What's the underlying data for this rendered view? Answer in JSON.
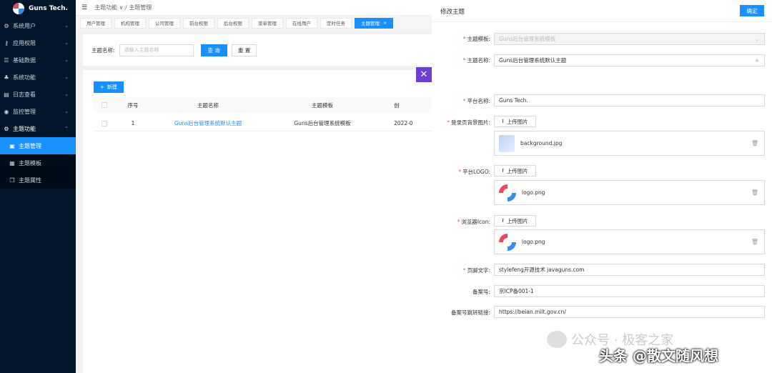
{
  "app": {
    "brand": "Guns Tech."
  },
  "sidebar": {
    "items": [
      {
        "label": "系统用户",
        "icon": "gear-icon"
      },
      {
        "label": "应用权限",
        "icon": "key-icon"
      },
      {
        "label": "基础数据",
        "icon": "list-icon"
      },
      {
        "label": "系统功能",
        "icon": "cluster-icon"
      },
      {
        "label": "日志查看",
        "icon": "file-icon"
      },
      {
        "label": "监控管理",
        "icon": "monitor-icon"
      },
      {
        "label": "主题功能",
        "icon": "gear-icon"
      }
    ],
    "subitems": [
      {
        "label": "主题管理"
      },
      {
        "label": "主题模板"
      },
      {
        "label": "主题属性"
      }
    ]
  },
  "header": {
    "breadcrumb": "主题功能 ∨ / 主题管理"
  },
  "tabs": [
    "用户管理",
    "机构管理",
    "公司管理",
    "前台权限",
    "后台权限",
    "菜单管理",
    "在线用户",
    "定时任务",
    "主题管理"
  ],
  "search": {
    "label": "主题名称:",
    "placeholder": "请输入主题名称",
    "query_label": "查 询",
    "reset_label": "重 置"
  },
  "table": {
    "new_label": "新建",
    "columns": [
      "序号",
      "主题名称",
      "主题模板",
      "创"
    ],
    "rows": [
      {
        "index": "1",
        "name": "Guns后台管理系统默认主题",
        "template": "Guns后台管理系统模板",
        "date": "2022-0"
      }
    ]
  },
  "drawer": {
    "title": "修改主题",
    "ok_label": "确定",
    "fields": {
      "template": {
        "label": "主题模板:",
        "value": "Guns后台管理系统模板"
      },
      "name": {
        "label": "主题名称:",
        "value": "Guns后台管理系统默认主题"
      },
      "platform_name": {
        "label": "平台名称:",
        "value": "Guns Tech."
      },
      "login_bg": {
        "label": "登录页背景图片:",
        "file": "background.jpg"
      },
      "platform_logo": {
        "label": "平台LOGO:",
        "file": "logo.png"
      },
      "browser_icon": {
        "label": "浏览器Icon:",
        "file": "logo.png"
      },
      "footer_text": {
        "label": "页脚文字:",
        "value": "stylefeng开源技术 javaguns.com"
      },
      "icp": {
        "label": "备案号:",
        "value": "京ICP备001-1"
      },
      "icp_link": {
        "label": "备案号跳转链接:",
        "value": "https://beian.miit.gov.cn/"
      }
    },
    "upload_label": "上传图片"
  },
  "watermark": {
    "line1": "公众号 · 极客之家",
    "line2": "头条 @散文随风想"
  }
}
